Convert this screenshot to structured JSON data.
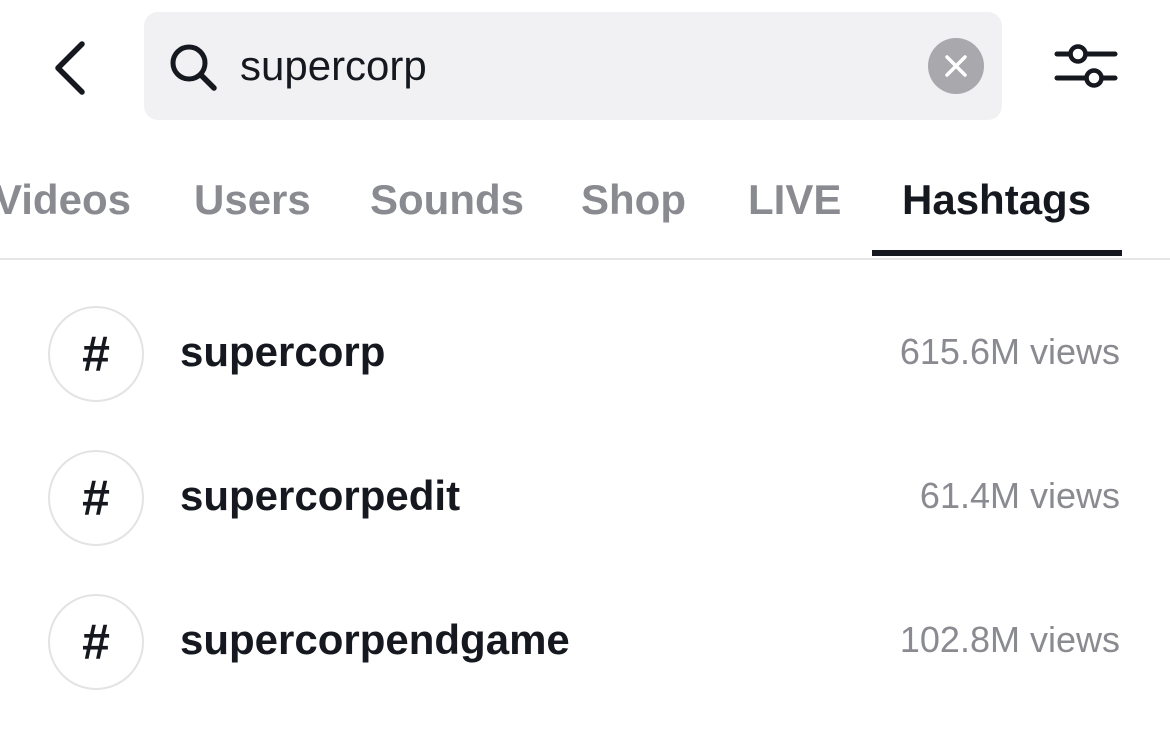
{
  "search": {
    "value": "supercorp",
    "placeholder": "Search"
  },
  "icons": {
    "back": "chevron-left-icon",
    "search": "search-icon",
    "clear": "close-icon",
    "filter": "sliders-icon",
    "hashtag": "hashtag-icon"
  },
  "tabs": [
    {
      "label": "Videos",
      "active": false
    },
    {
      "label": "Users",
      "active": false
    },
    {
      "label": "Sounds",
      "active": false
    },
    {
      "label": "Shop",
      "active": false
    },
    {
      "label": "LIVE",
      "active": false
    },
    {
      "label": "Hashtags",
      "active": true
    }
  ],
  "hashtags": [
    {
      "symbol": "#",
      "name": "supercorp",
      "views": "615.6M views"
    },
    {
      "symbol": "#",
      "name": "supercorpedit",
      "views": "61.4M views"
    },
    {
      "symbol": "#",
      "name": "supercorpendgame",
      "views": "102.8M views"
    }
  ],
  "colors": {
    "text_primary": "#16181f",
    "text_secondary": "#8a8b91",
    "search_bg": "#f1f1f3",
    "clear_button": "#a8a8ad"
  }
}
